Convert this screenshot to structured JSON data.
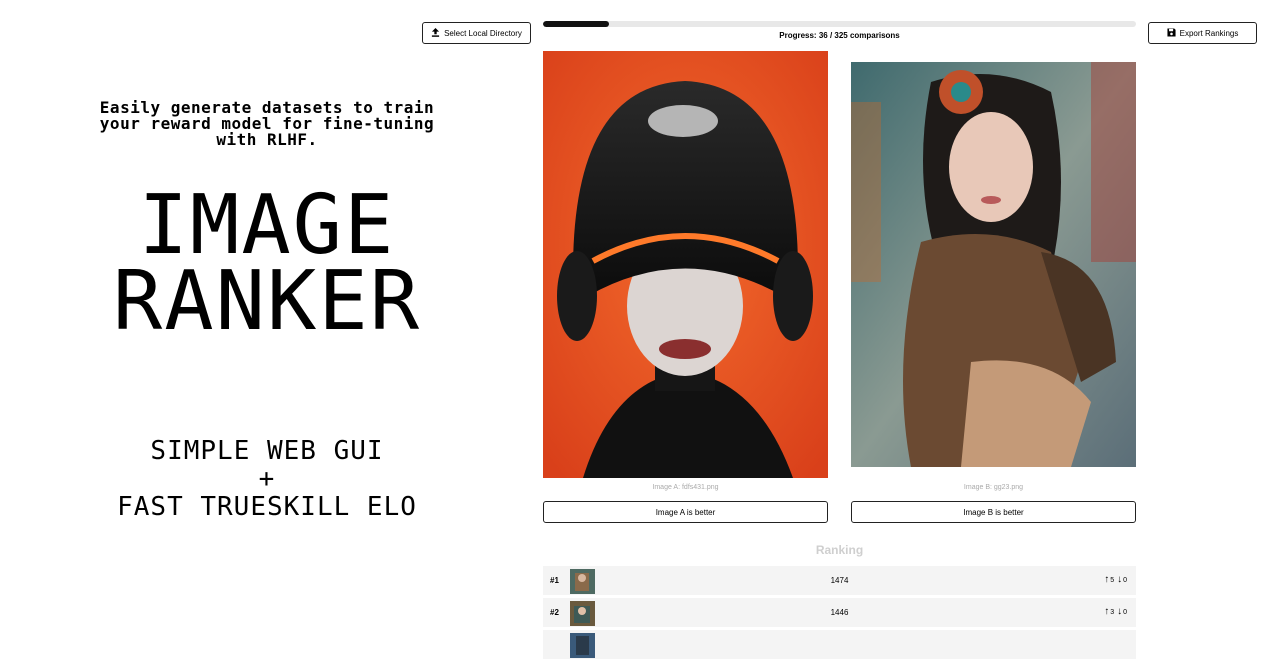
{
  "hero": {
    "tagline_lines": [
      "Easily generate datasets to train",
      "your reward model for fine-tuning",
      "with RLHF."
    ],
    "title_lines": [
      "IMAGE",
      "RANKER"
    ],
    "feature_lines": [
      "SIMPLE WEB GUI",
      "+",
      "FAST TRUESKILL ELO"
    ]
  },
  "toolbar": {
    "select_dir_label": "Select Local Directory",
    "export_label": "Export Rankings"
  },
  "progress": {
    "text": "Progress: 36 / 325 comparisons",
    "completed": 36,
    "total": 325
  },
  "comparison": {
    "image_a": {
      "caption": "Image A: fdfs431.png",
      "button_label": "Image A is better"
    },
    "image_b": {
      "caption": "Image B: gg23.png",
      "button_label": "Image B is better"
    }
  },
  "ranking": {
    "title": "Ranking",
    "rows": [
      {
        "rank": "#1",
        "score": "1474",
        "wins": "5",
        "losses": "0"
      },
      {
        "rank": "#2",
        "score": "1446",
        "wins": "3",
        "losses": "0"
      },
      {
        "rank": "",
        "score": "",
        "wins": "",
        "losses": ""
      }
    ]
  },
  "colors": {
    "accent": "#000000",
    "image_a_background": "#e8501e",
    "image_b_background": "#5b6e78"
  }
}
